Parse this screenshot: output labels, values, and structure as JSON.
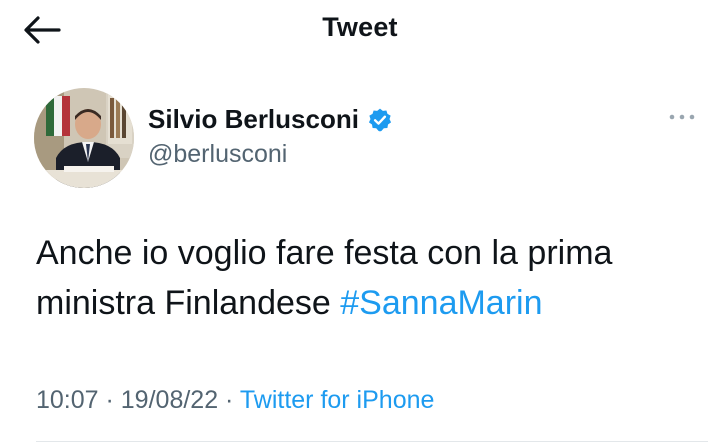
{
  "header": {
    "title": "Tweet",
    "back_icon": "arrow-left-icon"
  },
  "author": {
    "display_name": "Silvio Berlusconi",
    "handle": "@berlusconi",
    "verified": true,
    "verified_icon": "verified-badge-icon",
    "avatar": "avatar"
  },
  "more_icon": "more-horizontal-icon",
  "tweet": {
    "text_before_hashtag": "Anche io voglio fare festa con la prima ministra Finlandese ",
    "hashtag": "#SannaMarin"
  },
  "meta": {
    "time": "10:07",
    "separator": " · ",
    "date": "19/08/22",
    "source": "Twitter for iPhone"
  },
  "colors": {
    "text": "#0f1419",
    "secondary": "#536471",
    "accent": "#1d9bf0"
  }
}
